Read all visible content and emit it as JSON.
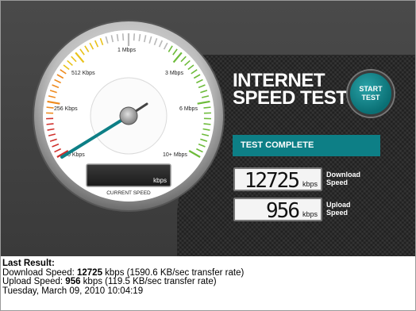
{
  "app": {
    "title_line1": "INTERNET",
    "title_line2": "SPEED TEST",
    "start_button": "START\nTEST"
  },
  "gauge": {
    "tick_labels": [
      "0 Kbps",
      "256 Kbps",
      "512 Kbps",
      "1 Mbps",
      "3 Mbps",
      "6 Mbps",
      "10+ Mbps"
    ],
    "current_speed_label": "CURRENT SPEED",
    "current_speed_value": "",
    "current_speed_unit": "kbps"
  },
  "status": {
    "text": "TEST COMPLETE"
  },
  "results": {
    "download_value": "12725",
    "download_unit": "kbps",
    "download_label": "Download\nSpeed",
    "upload_value": "956",
    "upload_unit": "kbps",
    "upload_label": "Upload\nSpeed"
  },
  "last_result": {
    "heading": "Last Result:",
    "download_prefix": "Download Speed: ",
    "download_value": "12725",
    "download_suffix": " kbps (1590.6 KB/sec transfer rate)",
    "upload_prefix": "Upload Speed: ",
    "upload_value": "956",
    "upload_suffix": " kbps (119.5 KB/sec transfer rate)",
    "timestamp": "Tuesday, March 09, 2010 10:04:19"
  },
  "colors": {
    "accent": "#0d7f86",
    "needle": "#0d7f86"
  }
}
